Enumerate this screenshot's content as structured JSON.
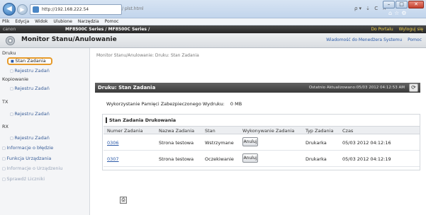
{
  "browser": {
    "url": "http://192.168.222.54",
    "url_suffix": "/ plst.html",
    "back_icon": "back-arrow-icon",
    "forward_icon": "forward-arrow-icon",
    "tools": "ρ▾ ⇣ C ✕",
    "menu": [
      "Plik",
      "Edycja",
      "Widok",
      "Ulubione",
      "Narzędzia",
      "Pomoc"
    ]
  },
  "brandbar": {
    "left": "canon",
    "model": "MF8500C Series / MF8500C Series /",
    "portal": "Do Portalu",
    "logout": "Wyloguj się"
  },
  "header": {
    "title": "Monitor Stanu/Anulowanie",
    "admin_msg": "Wiadomość do Menedżera Systemu",
    "help": "Pomoc"
  },
  "sidebar": {
    "druku": "Druku",
    "stan_zadania": "Stan Zadania",
    "rejestru_druk": "Rejestru Zadań",
    "kopiowanie": "Kopiowanie",
    "rejestru_kop": "Rejestru Zadań",
    "tx": "TX",
    "rejestru_tx": "Rejestru Zadań",
    "rx": "RX",
    "rejestru_rx": "Rejestru Zadań",
    "informacje_bledzie": "Informacje o błędzie",
    "funkcja": "Funkcja Urządzania",
    "informacje_urzadzeniu": "Informacje o Urządzeniu",
    "sprawdz": "Sprawdź Liczniki"
  },
  "main": {
    "breadcrumb": "Monitor Stanu/Anulowanie: Druku: Stan Zadania",
    "title": "Druku: Stan Zadania",
    "updated": "Ostatnio Aktualizowano:05/03 2012 04:12:53 AM",
    "memory_label": "Wykorzystanie Pamięci Zabezpieczonego Wydruku:",
    "memory_value": "0 MB",
    "panel_title": "Stan Zadania Drukowania",
    "columns": [
      "Numer Zadania",
      "Nazwa Zadania",
      "Stan",
      "Wykonywanie Zadania",
      "Typ Zadania",
      "Czas"
    ],
    "rows": [
      {
        "number": "0306",
        "name": "Strona testowa",
        "status": "Wstrzymane",
        "action": "Anuluj",
        "type": "Drukarka",
        "time": "05/03 2012 04:12:16"
      },
      {
        "number": "0307",
        "name": "Strona testowa",
        "status": "Oczekiwanie",
        "action": "Anuluj",
        "type": "Drukarka",
        "time": "05/03 2012 04:12:19"
      }
    ]
  }
}
